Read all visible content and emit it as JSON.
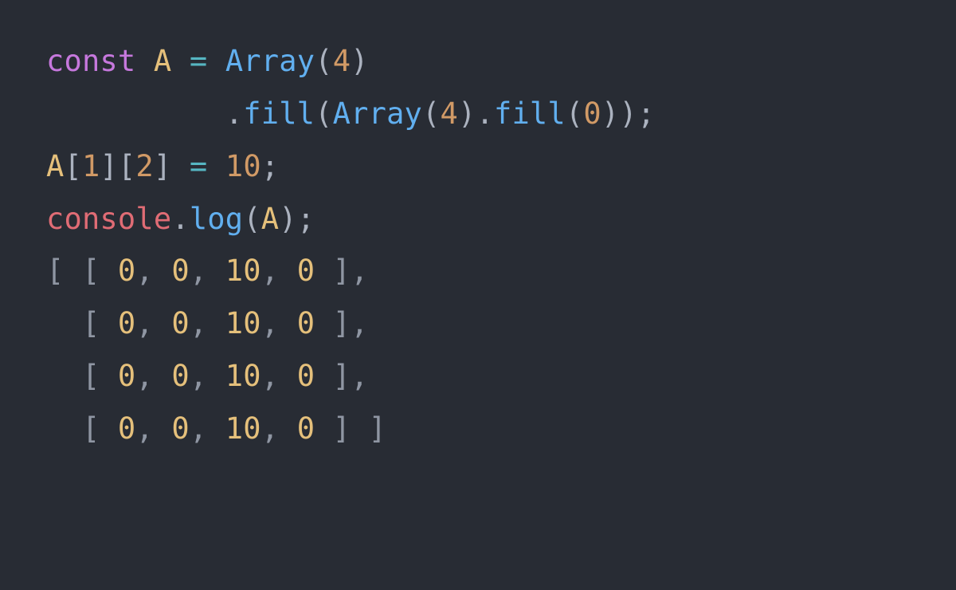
{
  "colors": {
    "background": "#282c34",
    "keyword": "#c678dd",
    "identifier": "#e5c07b",
    "operator": "#56b6c2",
    "function": "#61afef",
    "numeric": "#d19a66",
    "object": "#e06c75",
    "punctuation": "#abb2bf",
    "output_punctuation": "#8f96a3",
    "output_number": "#e5c07b"
  },
  "code": {
    "line1": {
      "kw_const": "const",
      "sp1": " ",
      "id_A": "A",
      "sp2": " ",
      "op_eq": "=",
      "sp3": " ",
      "fn_Array": "Array",
      "lp1": "(",
      "num_4a": "4",
      "rp1": ")"
    },
    "line2": {
      "indent": "          ",
      "dot1": ".",
      "fn_fill1": "fill",
      "lp2": "(",
      "fn_Array2": "Array",
      "lp3": "(",
      "num_4b": "4",
      "rp3": ")",
      "dot2": ".",
      "fn_fill2": "fill",
      "lp4": "(",
      "num_0": "0",
      "rp4": ")",
      "rp2": ")",
      "semi": ";"
    },
    "line3": {
      "id_A": "A",
      "lb1": "[",
      "num_1": "1",
      "rb1": "]",
      "lb2": "[",
      "num_2": "2",
      "rb2": "]",
      "sp1": " ",
      "op_eq": "=",
      "sp2": " ",
      "num_10": "10",
      "semi": ";"
    },
    "line4": {
      "obj_console": "console",
      "dot": ".",
      "fn_log": "log",
      "lp": "(",
      "id_A": "A",
      "rp": ")",
      "semi": ";"
    }
  },
  "output": {
    "rows": [
      {
        "prefix": "[ ",
        "cells": [
          "0",
          "0",
          "10",
          "0"
        ],
        "suffix": ","
      },
      {
        "prefix": "  ",
        "cells": [
          "0",
          "0",
          "10",
          "0"
        ],
        "suffix": ","
      },
      {
        "prefix": "  ",
        "cells": [
          "0",
          "0",
          "10",
          "0"
        ],
        "suffix": ","
      },
      {
        "prefix": "  ",
        "cells": [
          "0",
          "0",
          "10",
          "0"
        ],
        "suffix": " ]"
      }
    ],
    "open": "[ ",
    "close": " ]",
    "sep": ", "
  }
}
